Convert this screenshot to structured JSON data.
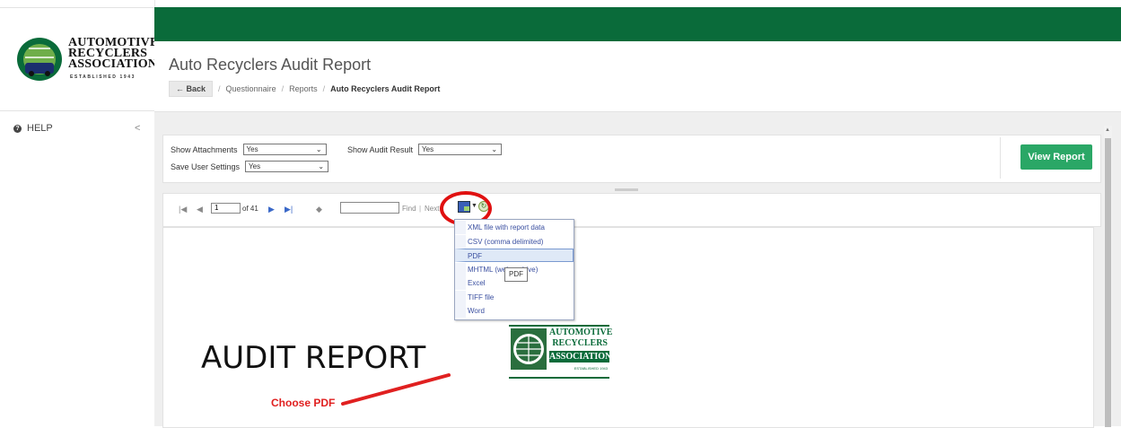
{
  "sidebar": {
    "logo_line1": "AUTOMOTIVE",
    "logo_line2": "RECYCLERS",
    "logo_line3": "ASSOCIATION",
    "logo_est": "ESTABLISHED 1943",
    "help_label": "HELP",
    "collapse_glyph": "<"
  },
  "header": {
    "title": "Auto Recyclers Audit Report",
    "back_label": "← Back",
    "crumbs": [
      "Questionnaire",
      "Reports",
      "Auto Recyclers Audit Report"
    ]
  },
  "params": {
    "show_attachments_label": "Show Attachments",
    "show_attachments_value": "Yes",
    "show_audit_result_label": "Show Audit Result",
    "show_audit_result_value": "Yes",
    "save_user_settings_label": "Save User Settings",
    "save_user_settings_value": "Yes",
    "view_report_label": "View Report"
  },
  "toolbar": {
    "page_value": "1",
    "of_label": "of 41",
    "find_label": "Find",
    "next_label": "Next"
  },
  "export_menu": {
    "items": [
      "XML file with report data",
      "CSV (comma delimited)",
      "PDF",
      "MHTML (web archive)",
      "Excel",
      "TIFF file",
      "Word"
    ],
    "selected_index": 2,
    "tooltip": "PDF"
  },
  "report": {
    "heading": "AUDIT REPORT",
    "logo_line1": "AUTOMOTIVE",
    "logo_line2": "RECYCLERS",
    "logo_line3": "ASSOCIATION",
    "logo_est": "ESTABLISHED 1943"
  },
  "annotation": {
    "text": "Choose PDF",
    "color": "#e02020"
  },
  "colors": {
    "brand_green": "#0a6b3a",
    "button_green": "#2aa766",
    "link_blue": "#3a4fa0"
  }
}
